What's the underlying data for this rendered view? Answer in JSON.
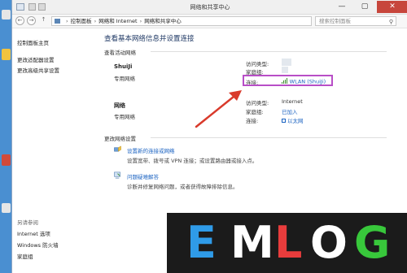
{
  "window": {
    "title": "网络和共享中心",
    "buttons": {
      "minimize": "—",
      "maximize": "▢",
      "close": "✕"
    }
  },
  "address_bar": {
    "back_icon": "back-arrow-icon",
    "forward_icon": "forward-arrow-icon",
    "up_icon": "up-arrow-icon",
    "path": [
      "控制面板",
      "网络和 Internet",
      "网络和共享中心"
    ],
    "search_placeholder": "搜索控制面板"
  },
  "left_pane": {
    "links": [
      "控制面板主页",
      "更改适配器设置",
      "更改高级共享设置"
    ],
    "see_also_label": "另请参阅",
    "see_also": [
      "Internet 选项",
      "Windows 防火墙",
      "家庭组"
    ]
  },
  "main": {
    "heading": "查看基本网络信息并设置连接",
    "active_networks_label": "查看活动网络",
    "networks": [
      {
        "name": "ShuiJi",
        "category": "专用网络",
        "access_label": "访问类型:",
        "access_value": "",
        "homegroup_label": "家庭组:",
        "homegroup_value": "",
        "connections_label": "连接:",
        "connection_value": "WLAN (ShuiJi)"
      },
      {
        "name": "网络",
        "category": "专用网络",
        "access_label": "访问类型:",
        "access_value": "Internet",
        "homegroup_label": "家庭组:",
        "homegroup_value": "已加入",
        "connections_label": "连接:",
        "connection_value": "以太网"
      }
    ],
    "change_settings_label": "更改网络设置",
    "tasks": [
      {
        "title": "设置新的连接或网络",
        "desc": "设置宽带、拨号或 VPN 连接；或设置路由器或接入点。",
        "icon": "new-connection-icon"
      },
      {
        "title": "问题疑难解答",
        "desc": "诊断并修复网络问题，或者获得故障排除信息。",
        "icon": "troubleshoot-icon"
      }
    ]
  },
  "watermark": {
    "letters": [
      "E",
      "M",
      "L",
      "O",
      "G"
    ],
    "colors": [
      "#2f9be8",
      "#ffffff",
      "#e83c3c",
      "#ffffff",
      "#38c73b"
    ]
  },
  "colors": {
    "highlight_border": "#b84ec7",
    "annotation_arrow": "#d93a2b",
    "link_blue": "#1a62c1"
  }
}
